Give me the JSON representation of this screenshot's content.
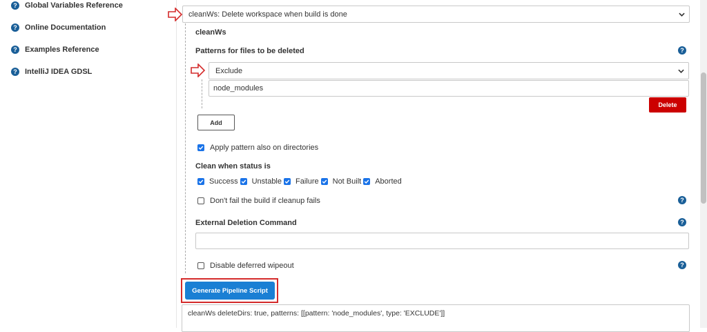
{
  "sidebar": {
    "items": [
      {
        "label": "Global Variables Reference",
        "icon": "help-icon"
      },
      {
        "label": "Online Documentation",
        "icon": "help-icon"
      },
      {
        "label": "Examples Reference",
        "icon": "help-icon"
      },
      {
        "label": "IntelliJ IDEA GDSL",
        "icon": "help-icon"
      }
    ]
  },
  "step": {
    "selected": "cleanWs: Delete workspace when build is done",
    "section_title": "cleanWs",
    "patterns_label": "Patterns for files to be deleted",
    "pattern_type": "Exclude",
    "pattern_value": "node_modules",
    "delete_label": "Delete",
    "add_label": "Add",
    "apply_dirs_label": "Apply pattern also on directories",
    "clean_status_label": "Clean when status is",
    "statuses": [
      "Success",
      "Unstable",
      "Failure",
      "Not Built",
      "Aborted"
    ],
    "dont_fail_label": "Don't fail the build if cleanup fails",
    "external_label": "External Deletion Command",
    "external_value": "",
    "disable_wipeout_label": "Disable deferred wipeout",
    "help_glyph": "?"
  },
  "generate_label": "Generate Pipeline Script",
  "output_script": "cleanWs deleteDirs: true, patterns: [[pattern: 'node_modules', type: 'EXCLUDE']]",
  "colors": {
    "accent": "#1a73e8",
    "delete": "#cc0000",
    "annotation": "#d42a2a",
    "help": "#1a5f98"
  }
}
